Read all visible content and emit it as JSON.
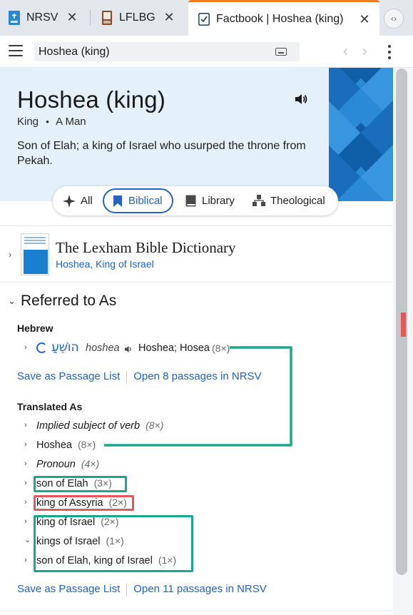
{
  "tabs": [
    {
      "label": "NRSV",
      "icon": "bible-icon",
      "active": false
    },
    {
      "label": "LFLBG",
      "icon": "book-icon",
      "active": false
    },
    {
      "label": "Factbook | Hoshea (king)",
      "icon": "factbook-icon",
      "active": true
    }
  ],
  "toolbar": {
    "search_value": "Hoshea (king)"
  },
  "header": {
    "title": "Hoshea (king)",
    "type": "King",
    "bullet": "•",
    "gender": "A Man",
    "description": "Son of Elah; a king of Israel who usurped the throne from Pekah."
  },
  "filters": [
    {
      "label": "All",
      "icon": "sparkle-icon"
    },
    {
      "label": "Biblical",
      "icon": "bookmark-icon",
      "active": true
    },
    {
      "label": "Library",
      "icon": "book-icon"
    },
    {
      "label": "Theological",
      "icon": "hierarchy-icon"
    }
  ],
  "resource": {
    "title": "The Lexham Bible Dictionary",
    "link": "Hoshea, King of Israel"
  },
  "referred": {
    "section_title": "Referred to As",
    "hebrew_label": "Hebrew",
    "hebrew_word": "הוֹשֵׁעַ",
    "hebrew_translit": "hoshea",
    "hebrew_gloss": "Hoshea; Hosea",
    "hebrew_count": "(8×)",
    "links1": {
      "save": "Save as Passage List",
      "open": "Open 8 passages in NRSV"
    },
    "translated_label": "Translated As",
    "translations": [
      {
        "text": "Implied subject of verb",
        "count": "(8×)",
        "italic": true
      },
      {
        "text": "Hoshea",
        "count": "(8×)",
        "italic": false
      },
      {
        "text": "Pronoun",
        "count": "(4×)",
        "italic": true
      },
      {
        "text": "son of Elah",
        "count": "(3×)",
        "italic": false
      },
      {
        "text": "king of Assyria",
        "count": "(2×)",
        "italic": false
      },
      {
        "text": "king of Israel",
        "count": "(2×)",
        "italic": false
      },
      {
        "text": "kings of Israel",
        "count": "(1×)",
        "italic": false
      },
      {
        "text": "son of Elah, king of Israel",
        "count": "(1×)",
        "italic": false
      }
    ],
    "links2": {
      "save": "Save as Passage List",
      "open": "Open 11 passages in NRSV"
    }
  },
  "colors": {
    "accent": "#2364c2",
    "active_tab_border": "#f47b20",
    "header_bg": "#e4f1fb",
    "annotation_green": "#1aa88a",
    "annotation_red": "#e05a5a"
  }
}
